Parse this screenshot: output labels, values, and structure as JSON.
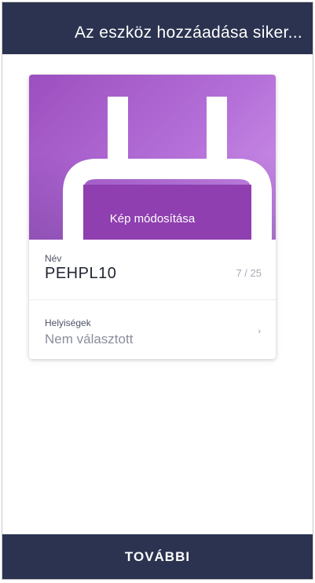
{
  "header": {
    "title": "Az eszköz hozzáadása siker..."
  },
  "device_card": {
    "change_image_label": "Kép módosítása",
    "image_icon": "plug-icon",
    "name_field": {
      "label": "Név",
      "value": "PEHPL10",
      "counter": "7 / 25"
    },
    "rooms_field": {
      "label": "Helyiségek",
      "value": "Nem választott",
      "chevron_icon": "chevron-right-icon"
    }
  },
  "footer": {
    "next_label": "TOVÁBBI"
  },
  "colors": {
    "bar": "#2b3350",
    "hero_start": "#9c4fbf",
    "hero_end": "#cf95ea"
  }
}
